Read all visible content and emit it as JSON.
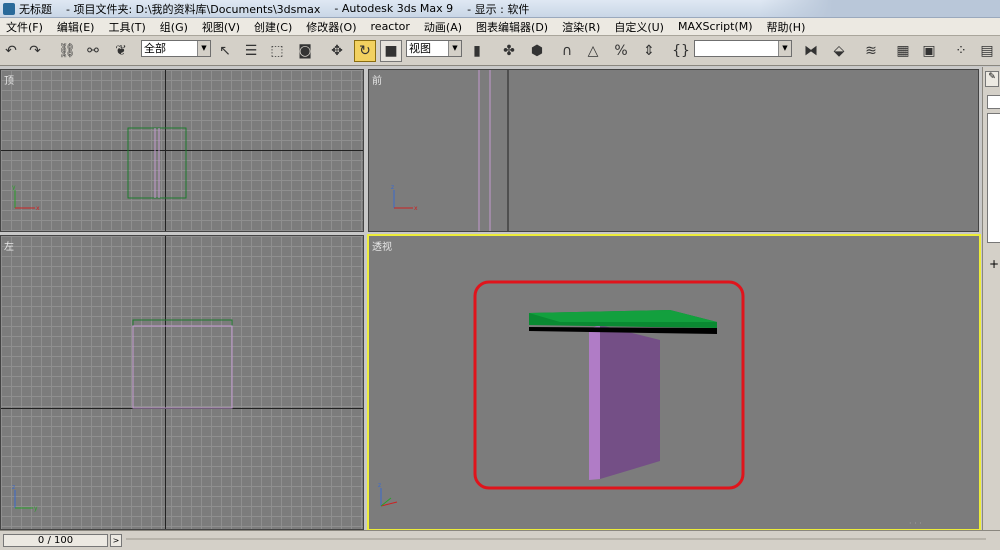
{
  "window": {
    "title_parts": [
      "无标题",
      "- 项目文件夹: D:\\我的资料库\\Documents\\3dsmax",
      "- Autodesk 3ds Max 9",
      "- 显示 : 软件"
    ]
  },
  "menu": [
    "文件(F)",
    "编辑(E)",
    "工具(T)",
    "组(G)",
    "视图(V)",
    "创建(C)",
    "修改器(O)",
    "reactor",
    "动画(A)",
    "图表编辑器(D)",
    "渲染(R)",
    "自定义(U)",
    "MAXScript(M)",
    "帮助(H)"
  ],
  "toolbar": {
    "selection_filter": "全部",
    "reference_coord": "视图",
    "named_selection": ""
  },
  "viewports": {
    "top_label": "顶",
    "front_label": "前",
    "left_label": "左",
    "perspective_label": "透视"
  },
  "statusbar": {
    "time_slider": "0 / 100",
    "time_arrow": ">"
  },
  "colors": {
    "active_border": "#eded39",
    "highlight_ellipse": "#e0141c",
    "tabletop_green": "#0a8a32",
    "leg_purple": "#b07cc6",
    "leg_purple_dark": "#744f86"
  }
}
